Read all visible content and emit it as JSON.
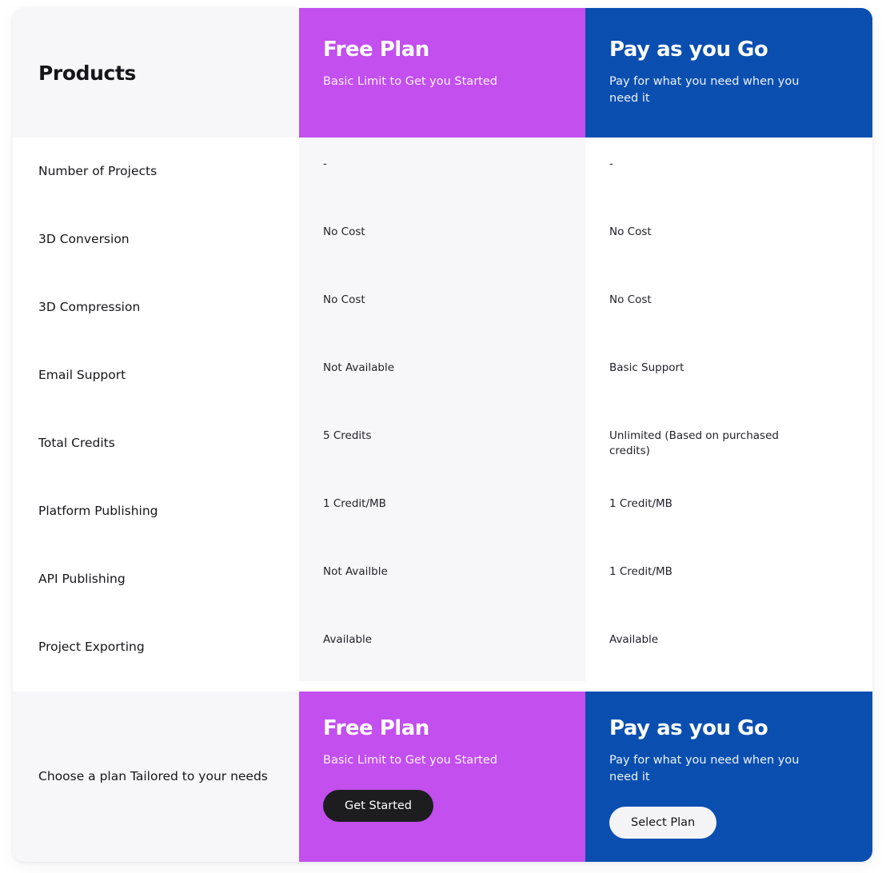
{
  "card": {
    "accent_purple": "#c24fee",
    "accent_blue": "#0a4fb0",
    "shade": "#f7f7fa"
  },
  "header": {
    "features_title": "Products",
    "plans": [
      {
        "name": "Free Plan",
        "tagline": "Basic Limit to Get you Started"
      },
      {
        "name": "Pay as you Go",
        "tagline": "Pay for what you need when you need it"
      }
    ]
  },
  "rows": [
    {
      "feature": "Number of Projects",
      "free": "-",
      "payg": "-"
    },
    {
      "feature": "3D Conversion",
      "free": "No Cost",
      "payg": "No Cost"
    },
    {
      "feature": "3D Compression",
      "free": "No Cost",
      "payg": "No Cost"
    },
    {
      "feature": "Email Support",
      "free": "Not Available",
      "payg": "Basic Support"
    },
    {
      "feature": "Total Credits",
      "free": "5 Credits",
      "payg": "Unlimited (Based on purchased credits)"
    },
    {
      "feature": "Platform Publishing",
      "free": "1 Credit/MB",
      "payg": "1 Credit/MB"
    },
    {
      "feature": "API Publishing",
      "free": "Not Availble",
      "payg": "1 Credit/MB"
    },
    {
      "feature": "Project Exporting",
      "free": "Available",
      "payg": "Available"
    }
  ],
  "footer": {
    "note": "Choose a plan Tailored to your needs",
    "plans": [
      {
        "name": "Free Plan",
        "tagline": "Basic Limit to Get you Started",
        "cta_label": "Get Started"
      },
      {
        "name": "Pay as you Go",
        "tagline": "Pay for what you need when you need it",
        "cta_label": "Select Plan"
      }
    ]
  }
}
